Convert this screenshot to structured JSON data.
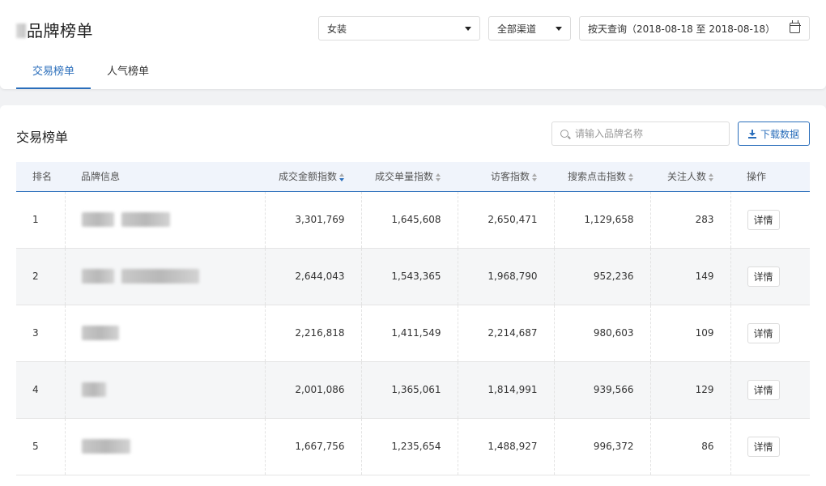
{
  "header": {
    "title": "品牌榜单",
    "category_select": "女装",
    "channel_select": "全部渠道",
    "date_range": "按天查询（2018-08-18 至 2018-08-18）",
    "tabs": [
      {
        "label": "交易榜单",
        "active": true
      },
      {
        "label": "人气榜单",
        "active": false
      }
    ]
  },
  "section": {
    "title": "交易榜单",
    "search_placeholder": "请输入品牌名称",
    "download_label": "下载数据"
  },
  "table": {
    "columns": [
      "排名",
      "品牌信息",
      "成交金额指数",
      "成交单量指数",
      "访客指数",
      "搜索点击指数",
      "关注人数",
      "操作"
    ],
    "action_label": "详情",
    "rows": [
      {
        "rank": "1",
        "amount": "3,301,769",
        "orders": "1,645,608",
        "visitors": "2,650,471",
        "search": "1,129,658",
        "followers": "283"
      },
      {
        "rank": "2",
        "amount": "2,644,043",
        "orders": "1,543,365",
        "visitors": "1,968,790",
        "search": "952,236",
        "followers": "149"
      },
      {
        "rank": "3",
        "amount": "2,216,818",
        "orders": "1,411,549",
        "visitors": "2,214,687",
        "search": "980,603",
        "followers": "109"
      },
      {
        "rank": "4",
        "amount": "2,001,086",
        "orders": "1,365,061",
        "visitors": "1,814,991",
        "search": "939,566",
        "followers": "129"
      },
      {
        "rank": "5",
        "amount": "1,667,756",
        "orders": "1,235,654",
        "visitors": "1,488,927",
        "search": "996,372",
        "followers": "86"
      }
    ]
  },
  "colors": {
    "accent": "#2a6ebb"
  }
}
